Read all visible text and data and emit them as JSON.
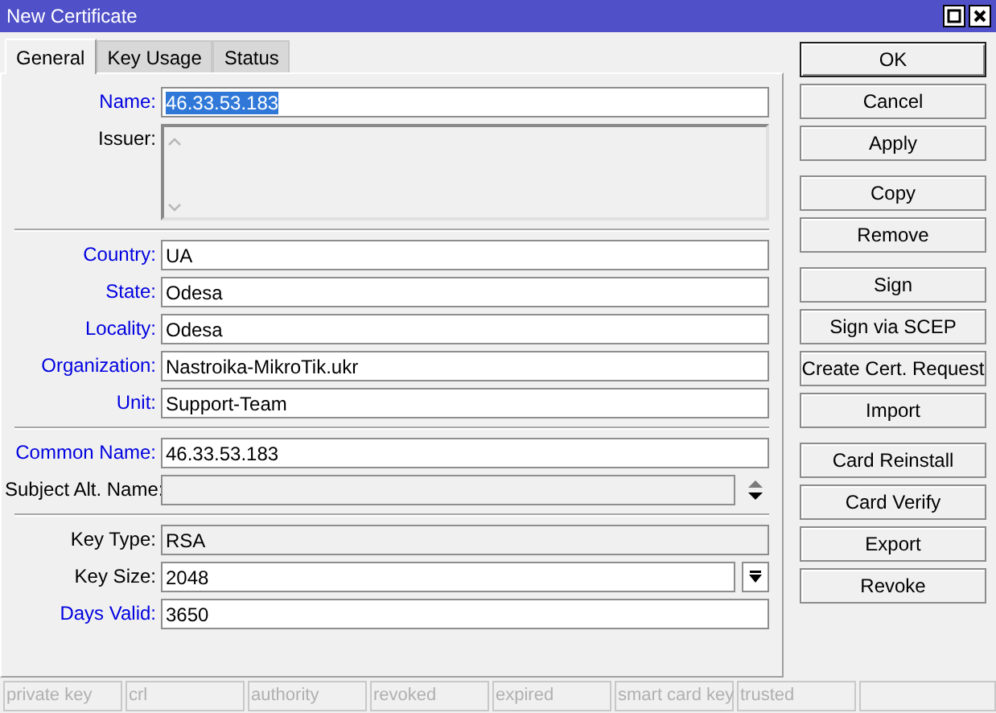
{
  "window": {
    "title": "New Certificate"
  },
  "tabs": [
    {
      "label": "General",
      "selected": true
    },
    {
      "label": "Key Usage",
      "selected": false
    },
    {
      "label": "Status",
      "selected": false
    }
  ],
  "form": {
    "sections": [
      [
        {
          "label": "Name:",
          "required": true,
          "kind": "text",
          "value": "46.33.53.183",
          "disabled": false,
          "text_selected": true
        },
        {
          "label": "Issuer:",
          "required": false,
          "kind": "textarea",
          "disabled": true
        }
      ],
      [
        {
          "label": "Country:",
          "required": true,
          "kind": "text",
          "value": "UA",
          "disabled": false
        },
        {
          "label": "State:",
          "required": true,
          "kind": "text",
          "value": "Odesa",
          "disabled": false
        },
        {
          "label": "Locality:",
          "required": true,
          "kind": "text",
          "value": "Odesa",
          "disabled": false
        },
        {
          "label": "Organization:",
          "required": true,
          "kind": "text",
          "value": "Nastroika-MikroTik.ukr",
          "disabled": false
        },
        {
          "label": "Unit:",
          "required": true,
          "kind": "text",
          "value": "Support-Team",
          "disabled": false
        }
      ],
      [
        {
          "label": "Common Name:",
          "required": true,
          "kind": "text",
          "value": "46.33.53.183",
          "disabled": false
        },
        {
          "label": "Subject Alt. Name:",
          "required": false,
          "kind": "list",
          "disabled": true
        }
      ],
      [
        {
          "label": "Key Type:",
          "required": false,
          "kind": "text",
          "value": "RSA",
          "disabled": true
        },
        {
          "label": "Key Size:",
          "required": false,
          "kind": "dropdown",
          "value": "2048",
          "disabled": false
        },
        {
          "label": "Days Valid:",
          "required": true,
          "kind": "text",
          "value": "3650",
          "disabled": false
        }
      ]
    ]
  },
  "button_groups": [
    [
      {
        "label": "OK",
        "default": true
      },
      {
        "label": "Cancel",
        "default": false
      },
      {
        "label": "Apply",
        "default": false
      }
    ],
    [
      {
        "label": "Copy",
        "default": false
      },
      {
        "label": "Remove",
        "default": false
      }
    ],
    [
      {
        "label": "Sign",
        "default": false
      },
      {
        "label": "Sign via SCEP",
        "default": false
      },
      {
        "label": "Create Cert. Request",
        "default": false
      },
      {
        "label": "Import",
        "default": false
      }
    ],
    [
      {
        "label": "Card Reinstall",
        "default": false
      },
      {
        "label": "Card Verify",
        "default": false
      },
      {
        "label": "Export",
        "default": false
      },
      {
        "label": "Revoke",
        "default": false
      }
    ]
  ],
  "status_bar": [
    "private key",
    "crl",
    "authority",
    "revoked",
    "expired",
    "smart card key",
    "trusted"
  ]
}
